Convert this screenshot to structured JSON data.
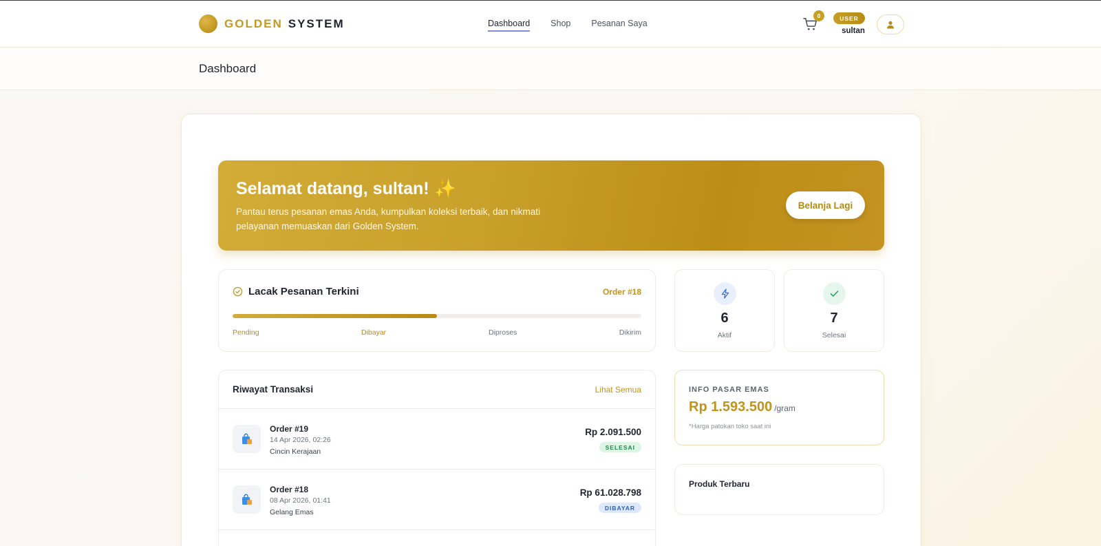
{
  "brand": {
    "gold": "GOLDEN",
    "system": "SYSTEM",
    "accent_color": "#c29a1f"
  },
  "nav": {
    "items": [
      {
        "label": "Dashboard",
        "active": true
      },
      {
        "label": "Shop",
        "active": false
      },
      {
        "label": "Pesanan Saya",
        "active": false
      }
    ]
  },
  "header_right": {
    "cart_icon": "cart-icon",
    "cart_count": "0",
    "role": "USER",
    "username": "sultan",
    "profile_icon": "user-icon"
  },
  "page": {
    "title": "Dashboard"
  },
  "hero": {
    "title": "Selamat datang, sultan!",
    "sparkle": "✨",
    "description": "Pantau terus pesanan emas Anda, kumpulkan koleksi terbaik, dan nikmati pelayanan memuaskan dari Golden System.",
    "button_label": "Belanja Lagi"
  },
  "tracking": {
    "title": "Lacak Pesanan Terkini",
    "order": "Order #18",
    "progress_percent": 50,
    "steps": [
      {
        "label": "Pending",
        "done": true
      },
      {
        "label": "Dibayar",
        "done": true
      },
      {
        "label": "Diproses",
        "done": false
      },
      {
        "label": "Dikirim",
        "done": false
      }
    ]
  },
  "stats": [
    {
      "icon": "lightning-icon",
      "value": "6",
      "label": "Aktif",
      "color": "#3b6fd8"
    },
    {
      "icon": "check-icon",
      "value": "7",
      "label": "Selesai",
      "color": "#22a05a"
    }
  ],
  "history": {
    "title": "Riwayat Transaksi",
    "see_all": "Lihat Semua",
    "rows": [
      {
        "order": "Order #19",
        "date": "14 Apr 2026, 02:26",
        "product": "Cincin Kerajaan",
        "amount": "Rp 2.091.500",
        "status": "SELESAI"
      },
      {
        "order": "Order #18",
        "date": "08 Apr 2026, 01:41",
        "product": "Gelang Emas",
        "amount": "Rp 61.028.798",
        "status": "DIBAYAR"
      }
    ]
  },
  "market": {
    "label": "INFO PASAR EMAS",
    "price": "Rp 1.593.500",
    "unit": "/gram",
    "note": "*Harga patokan toko saat ini"
  },
  "new_products": {
    "title": "Produk Terbaru"
  }
}
